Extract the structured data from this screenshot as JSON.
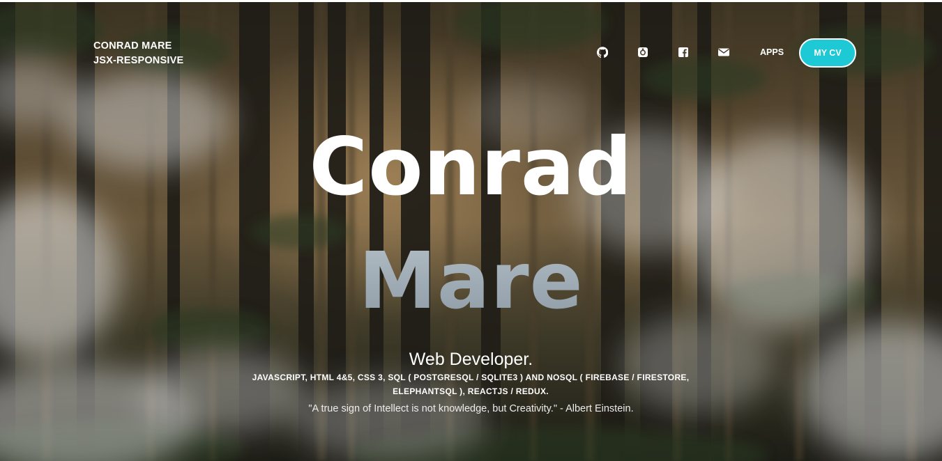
{
  "brand": {
    "name": "CONRAD MARE",
    "tagline": "JSX-RESPONSIVE"
  },
  "nav": {
    "icons": [
      "github-icon",
      "gitlab-icon",
      "facebook-icon",
      "mail-icon"
    ],
    "apps_label": "APPS",
    "cv_label": "MY CV",
    "accent_color": "#1ec9d6"
  },
  "hero": {
    "first_name": "Conrad",
    "last_name": "Mare",
    "role": "Web Developer.",
    "skills": "JAVASCRIPT, HTML 4&5, CSS 3, SQL ( POSTGRESQL / SQLITE3 ) AND NOSQL ( FIREBASE / FIRESTORE, ELEPHANTSQL ), REACTJS / REDUX.",
    "quote": "\"A true sign of Intellect is not knowledge, but Creativity.\" - Albert Einstein."
  }
}
